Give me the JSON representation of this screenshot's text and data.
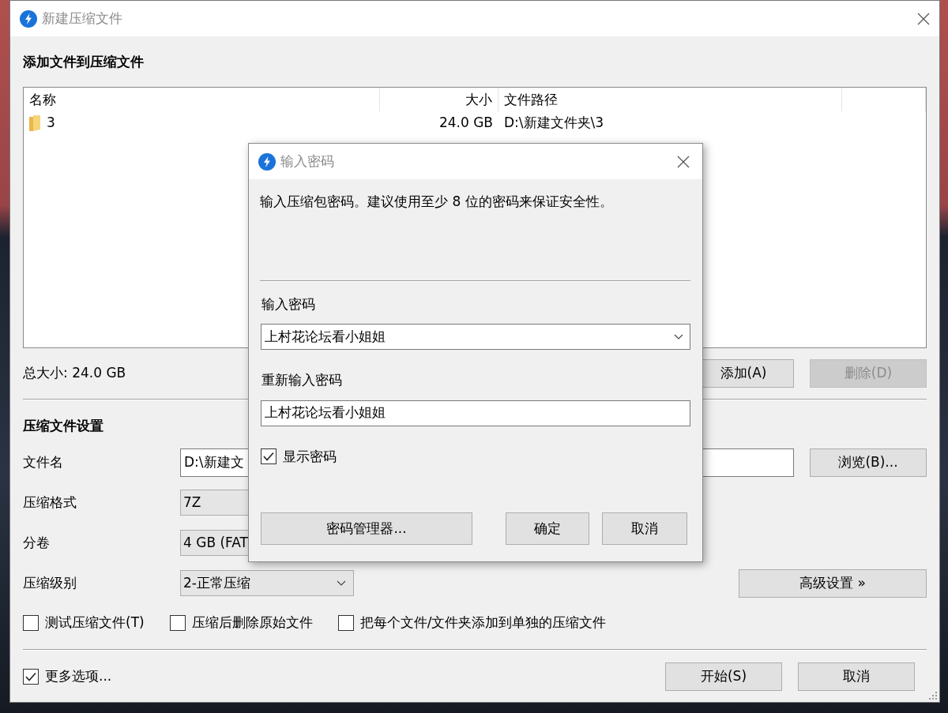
{
  "window": {
    "title": "新建压缩文件"
  },
  "files_section": {
    "heading": "添加文件到压缩文件",
    "columns": [
      "名称",
      "大小",
      "文件路径"
    ],
    "rows": [
      {
        "name": "3",
        "size": "24.0 GB",
        "path": "D:\\新建文件夹\\3"
      }
    ],
    "total": "总大小: 24.0 GB",
    "buttons": [
      {
        "label": "添加(A)",
        "disabled": false
      },
      {
        "label": "删除(D)",
        "disabled": true
      }
    ]
  },
  "settings": {
    "heading": "压缩文件设置",
    "fields": [
      {
        "kind": "text",
        "label": "文件名",
        "value": "D:\\新建文"
      },
      {
        "kind": "select",
        "label": "压缩格式",
        "value": "7Z"
      },
      {
        "kind": "select",
        "label": "分卷",
        "value": "4 GB (FAT"
      },
      {
        "kind": "dropdown",
        "label": "压缩级别",
        "value": "2-正常压缩"
      }
    ],
    "browse_button": "浏览(B)...",
    "advanced_button": "高级设置 »",
    "options": [
      {
        "label": "测试压缩文件(T)",
        "checked": false
      },
      {
        "label": "压缩后删除原始文件",
        "checked": false
      },
      {
        "label": "把每个文件/文件夹添加到单独的压缩文件",
        "checked": false
      }
    ]
  },
  "footer": {
    "more_options": {
      "label": "更多选项...",
      "checked": true
    },
    "buttons": [
      "开始(S)",
      "取消"
    ]
  },
  "password_dialog": {
    "title": "输入密码",
    "message": "输入压缩包密码。建议使用至少 8 位的密码来保证安全性。",
    "password_label": "输入密码",
    "password": "上村花论坛看小姐姐",
    "confirm_label": "重新输入密码",
    "confirm": "上村花论坛看小姐姐",
    "show_password": {
      "label": "显示密码",
      "checked": true
    },
    "buttons": [
      "密码管理器...",
      "确定",
      "取消"
    ]
  }
}
